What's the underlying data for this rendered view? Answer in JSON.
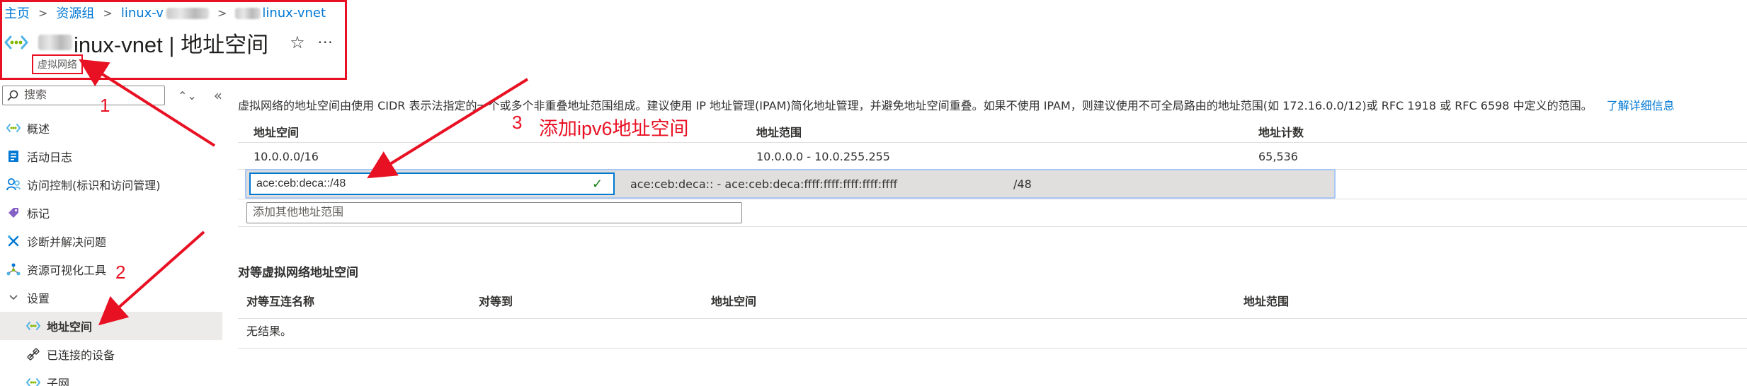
{
  "breadcrumb": {
    "items": [
      "主页",
      "资源组",
      "linux-v",
      "linux-vnet"
    ]
  },
  "header": {
    "title": "inux-vnet | 地址空间",
    "subtitle": "虚拟网络",
    "favorite_icon": "star-icon",
    "more_icon": "more-icon"
  },
  "search": {
    "placeholder": "搜索"
  },
  "sidebar": {
    "items": [
      {
        "label": "概述",
        "icon": "overview-icon"
      },
      {
        "label": "活动日志",
        "icon": "activity-log-icon"
      },
      {
        "label": "访问控制(标识和访问管理)",
        "icon": "access-control-icon"
      },
      {
        "label": "标记",
        "icon": "tag-icon"
      },
      {
        "label": "诊断并解决问题",
        "icon": "diagnose-icon"
      },
      {
        "label": "资源可视化工具",
        "icon": "visualizer-icon"
      },
      {
        "label": "设置",
        "icon": "chevron-down-icon"
      },
      {
        "label": "地址空间",
        "icon": "address-space-icon"
      },
      {
        "label": "已连接的设备",
        "icon": "connected-devices-icon"
      },
      {
        "label": "子网",
        "icon": "subnet-icon"
      }
    ]
  },
  "main": {
    "description": "虚拟网络的地址空间由使用 CIDR 表示法指定的一个或多个非重叠地址范围组成。建议使用 IP 地址管理(IPAM)简化地址管理，并避免地址空间重叠。如果不使用 IPAM，则建议使用不可全局路由的地址范围(如 172.16.0.0/12)或 RFC 1918 或 RFC 6598 中定义的范围。",
    "learn_more": "了解详细信息",
    "columns": [
      "地址空间",
      "地址范围",
      "地址计数"
    ],
    "rows": [
      {
        "space": "10.0.0.0/16",
        "range": "10.0.0.0 - 10.0.255.255",
        "count": "65,536"
      }
    ],
    "edit_row": {
      "value": "ace:ceb:deca::/48",
      "range": "ace:ceb:deca:: - ace:ceb:deca:ffff:ffff:ffff:ffff:ffff",
      "prefix": "/48"
    },
    "add_placeholder": "添加其他地址范围",
    "peer_section_title": "对等虚拟网络地址空间",
    "peer_columns": [
      "对等互连名称",
      "对等到",
      "地址空间",
      "地址范围"
    ],
    "no_results": "无结果。"
  },
  "annotations": {
    "label_1": "1",
    "label_2": "2",
    "label_3": "3",
    "note_3": "添加ipv6地址空间",
    "color": "#e81123"
  }
}
